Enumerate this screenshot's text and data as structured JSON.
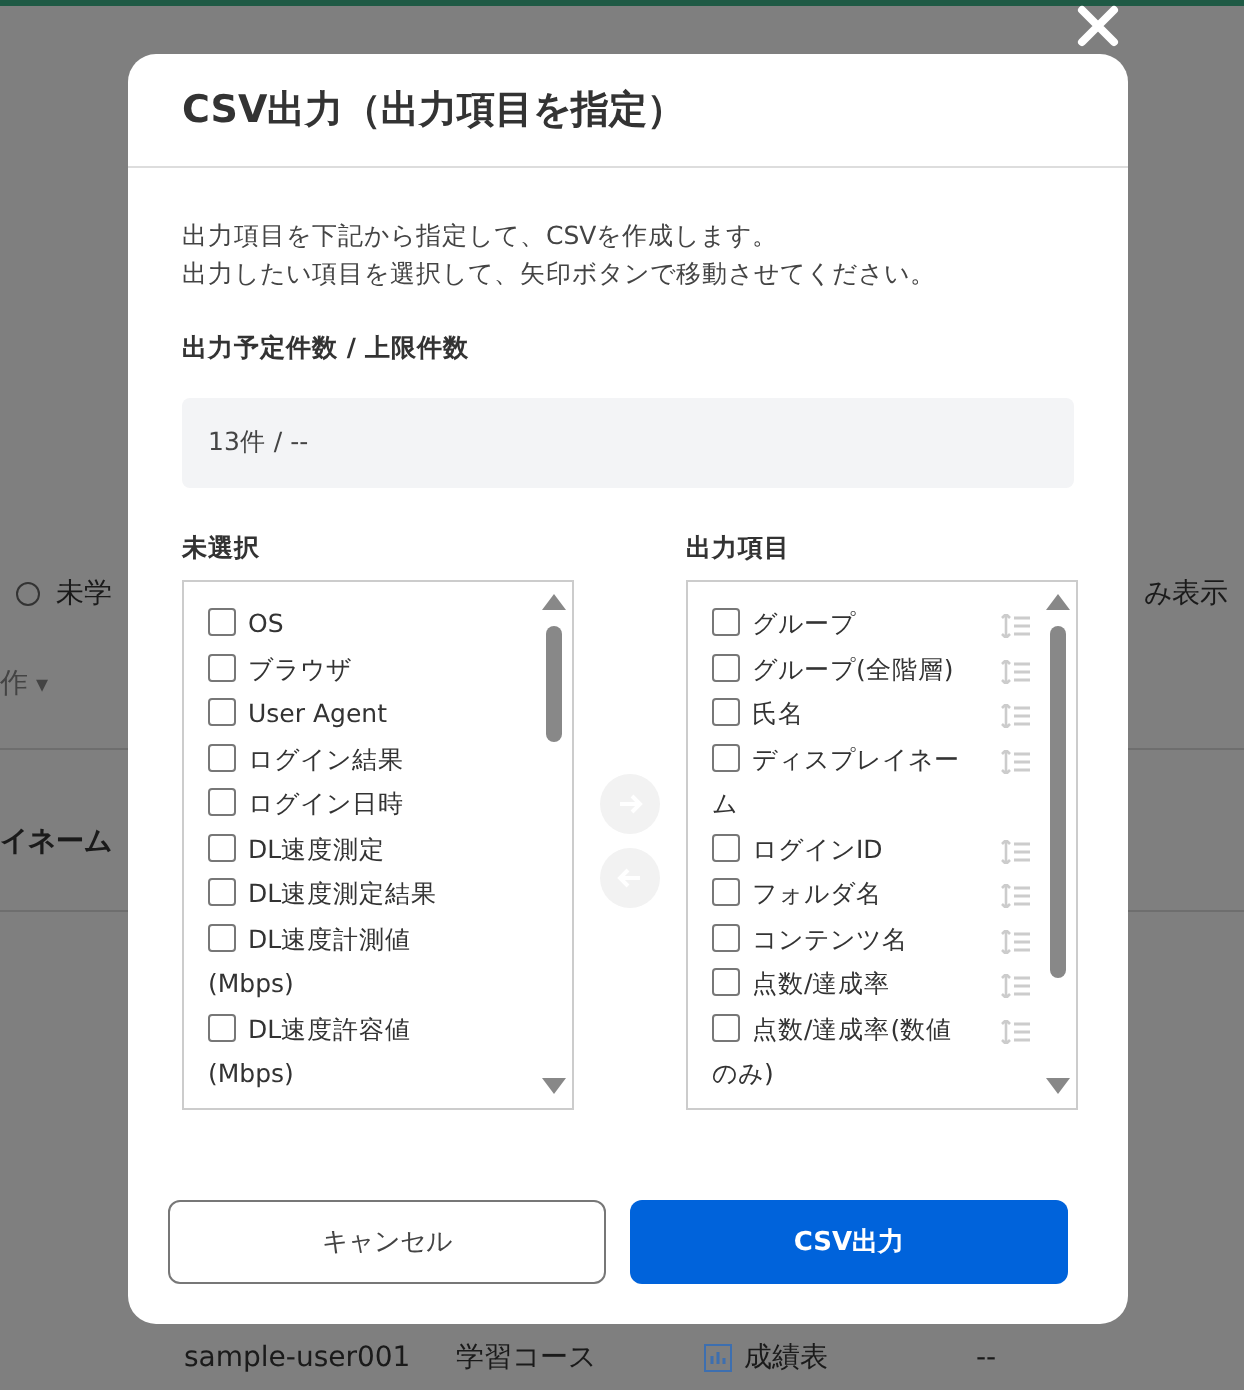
{
  "background_page": {
    "filter_radio": {
      "selected": false
    },
    "filter_option": "未学",
    "filter_option_right": "み表示",
    "dropdown": "作",
    "dropdown_caret": "▾",
    "column_header": "イネーム",
    "row": {
      "user": "sample-user001",
      "course": "学習コース",
      "report": "成績表",
      "value": "--"
    }
  },
  "dialog": {
    "title": "CSV出力（出力項目を指定）",
    "description": [
      "出力項目を下記から指定して、CSVを作成します。",
      "出力したい項目を選択して、矢印ボタンで移動させてください。"
    ],
    "count_label": "出力予定件数 / 上限件数",
    "count_value": "13件 / --",
    "unselected": {
      "label": "未選択",
      "items": [
        {
          "text": "OS",
          "checked": false
        },
        {
          "text": "ブラウザ",
          "checked": false
        },
        {
          "text": "User Agent",
          "checked": false
        },
        {
          "text": "ログイン結果",
          "checked": false
        },
        {
          "text": "ログイン日時",
          "checked": false
        },
        {
          "text": "DL速度測定",
          "checked": false
        },
        {
          "text": "DL速度測定結果",
          "checked": false
        },
        {
          "text": "DL速度計測値 (Mbps)",
          "checked": false
        },
        {
          "text": "DL速度許容値 (Mbps)",
          "checked": false
        }
      ]
    },
    "output": {
      "label": "出力項目",
      "items": [
        {
          "text": "グループ",
          "checked": false
        },
        {
          "text": "グループ(全階層)",
          "checked": false
        },
        {
          "text": "氏名",
          "checked": false
        },
        {
          "text": "ディスプレイネーム",
          "checked": false
        },
        {
          "text": "ログインID",
          "checked": false
        },
        {
          "text": "フォルダ名",
          "checked": false
        },
        {
          "text": "コンテンツ名",
          "checked": false
        },
        {
          "text": "点数/達成率",
          "checked": false
        },
        {
          "text": "点数/達成率(数値のみ)",
          "checked": false
        }
      ]
    },
    "move_right_button": {
      "disabled": true
    },
    "move_left_button": {
      "disabled": true
    },
    "buttons": [
      {
        "label": "キャンセル",
        "kind": "secondary"
      },
      {
        "label": "CSV出力",
        "kind": "primary"
      }
    ]
  }
}
